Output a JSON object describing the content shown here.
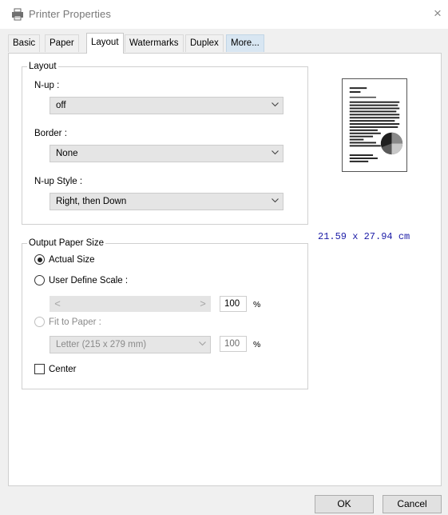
{
  "window": {
    "title": "Printer Properties",
    "close_glyph": "×"
  },
  "tabs": [
    {
      "label": "Basic"
    },
    {
      "label": "Paper"
    },
    {
      "label": "Layout"
    },
    {
      "label": "Watermarks"
    },
    {
      "label": "Duplex"
    },
    {
      "label": "More..."
    }
  ],
  "active_tab": "Layout",
  "layout_group": {
    "title": "Layout",
    "nup_label": "N-up :",
    "nup_value": "off",
    "border_label": "Border :",
    "border_value": "None",
    "nup_style_label": "N-up Style :",
    "nup_style_value": "Right, then Down"
  },
  "output_group": {
    "title": "Output Paper Size",
    "actual_size_label": "Actual Size",
    "actual_size_checked": true,
    "user_scale_label": "User Define Scale :",
    "user_scale_checked": false,
    "scale_left_glyph": "<",
    "scale_right_glyph": ">",
    "scale_value": "100",
    "scale_unit": "%",
    "fit_label": "Fit to Paper :",
    "fit_checked": false,
    "fit_paper_value": "Letter (215 x 279 mm)",
    "fit_value": "100",
    "fit_unit": "%",
    "center_label": "Center",
    "center_checked": false
  },
  "paper_dimensions": "21.59 x 27.94 cm",
  "buttons": {
    "ok": "OK",
    "cancel": "Cancel"
  },
  "icons": [
    "printer-icon",
    "close-icon",
    "chevron-down-icon",
    "page-preview-icon"
  ],
  "colors": {
    "accent": "#d8e6f2",
    "dimension_text": "#1a1aa6",
    "dialog_bg": "#f0f0f0"
  }
}
